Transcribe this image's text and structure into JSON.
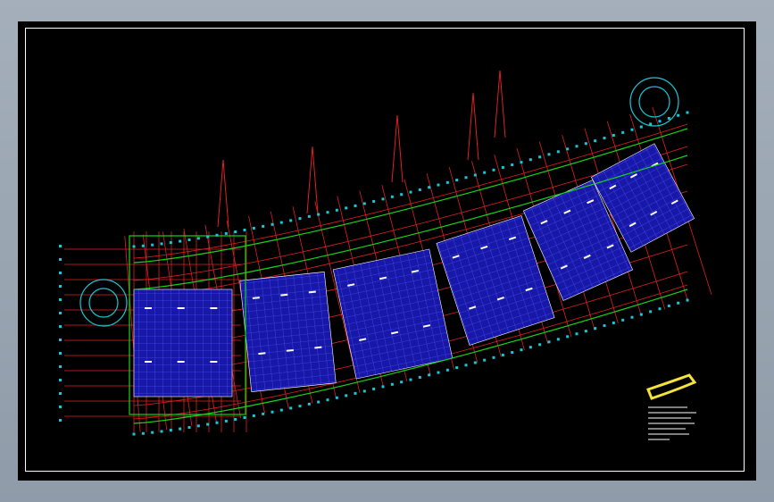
{
  "drawing": {
    "background": "#000000",
    "frame_color": "#ffffff",
    "colors": {
      "grid": "#e02020",
      "wall": "#19d319",
      "column": "#19c8d8",
      "room_fill": "#1a1ab0",
      "room_line": "#5a5aff",
      "label": "#ffffff",
      "accent": "#f5e23b"
    }
  },
  "legend": {
    "stamp_text": "",
    "notes": []
  }
}
